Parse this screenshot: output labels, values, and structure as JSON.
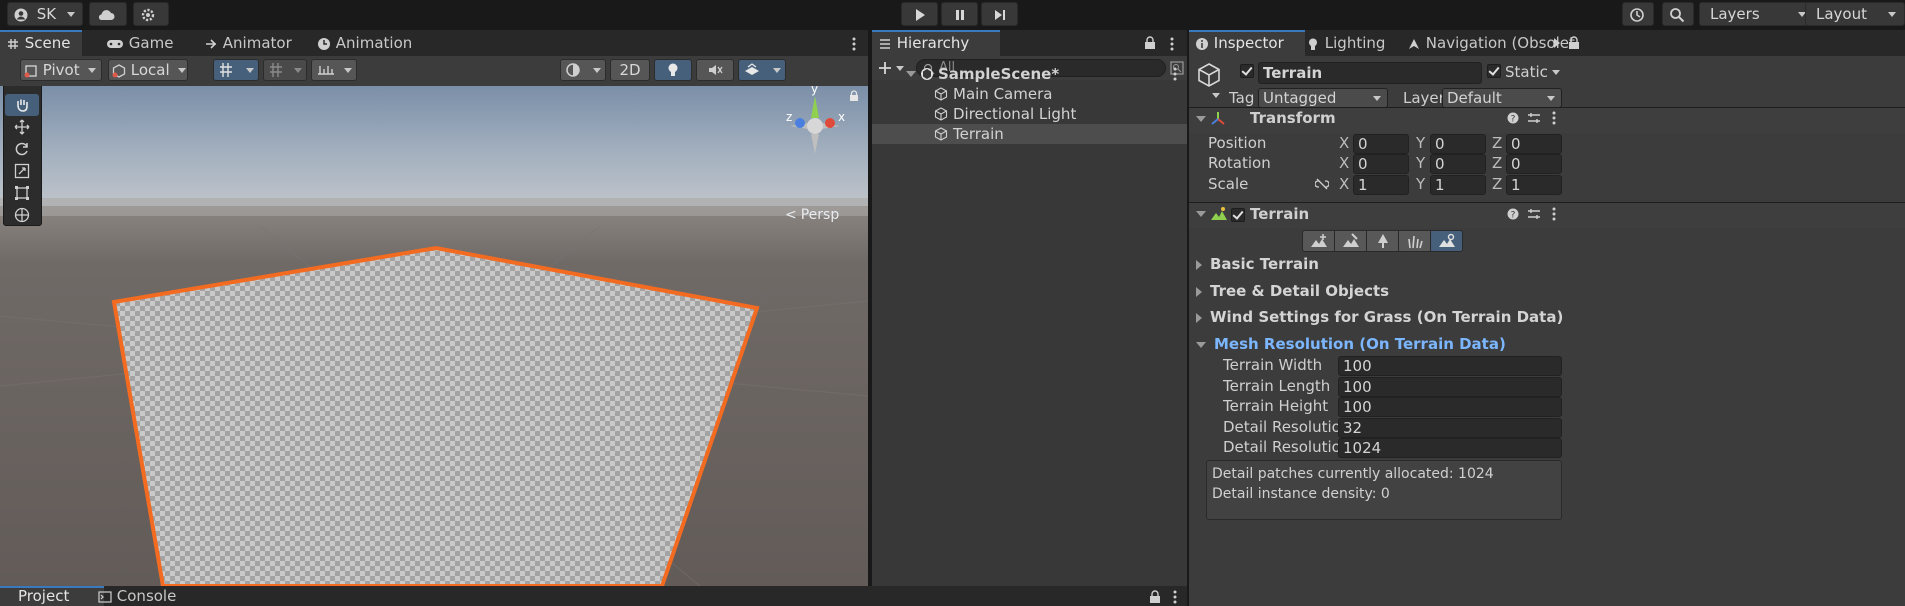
{
  "topbar": {
    "account_label": "SK",
    "layers_label": "Layers",
    "layout_label": "Layout"
  },
  "scene_tabs": {
    "tabs": [
      "Scene",
      "Game",
      "Animator",
      "Animation"
    ],
    "pivot_label": "Pivot",
    "local_label": "Local",
    "mode_2d_label": "2D",
    "persp_label": "Persp",
    "gizmo_y": "y",
    "gizmo_x": "x",
    "gizmo_z": "z"
  },
  "hierarchy": {
    "tab_label": "Hierarchy",
    "search_placeholder": "All",
    "scene_name": "SampleScene*",
    "items": [
      "Main Camera",
      "Directional Light",
      "Terrain"
    ],
    "selected_item": "Terrain"
  },
  "inspector": {
    "tabs": [
      "Inspector",
      "Lighting",
      "Navigation (Obsolete"
    ],
    "object_name": "Terrain",
    "static_label": "Static",
    "tag_label": "Tag",
    "tag_value": "Untagged",
    "layer_label": "Layer",
    "layer_value": "Default",
    "transform": {
      "title": "Transform",
      "position_label": "Position",
      "rotation_label": "Rotation",
      "scale_label": "Scale",
      "position": [
        "0",
        "0",
        "0"
      ],
      "rotation": [
        "0",
        "0",
        "0"
      ],
      "scale": [
        "1",
        "1",
        "1"
      ],
      "axes": [
        "X",
        "Y",
        "Z"
      ]
    },
    "terrain": {
      "title": "Terrain",
      "foldouts": [
        "Basic Terrain",
        "Tree & Detail Objects",
        "Wind Settings for Grass (On Terrain Data)"
      ],
      "mesh_title": "Mesh Resolution (On Terrain Data)",
      "fields": [
        {
          "label": "Terrain Width",
          "value": "100"
        },
        {
          "label": "Terrain Length",
          "value": "100"
        },
        {
          "label": "Terrain Height",
          "value": "100"
        },
        {
          "label": "Detail Resolution P",
          "value": "32"
        },
        {
          "label": "Detail Resolution",
          "value": "1024"
        }
      ],
      "info_line1": "Detail patches currently allocated: 1024",
      "info_line2": "Detail instance density: 0"
    }
  },
  "bottom": {
    "tabs": [
      "Project",
      "Console"
    ]
  },
  "colors": {
    "accent": "#3a79bb",
    "selection_outline": "#f26b21",
    "mesh_header": "#7bb6ff"
  }
}
